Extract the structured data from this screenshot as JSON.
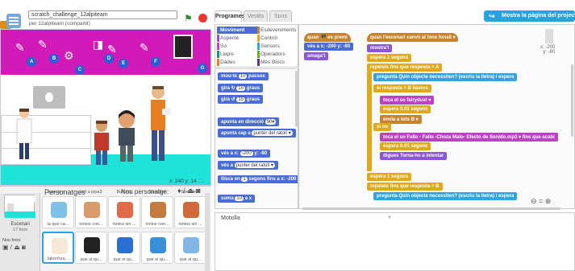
{
  "project": {
    "title": "scratch_challenge_12alpiteam",
    "author": "per 12alpiteam (compartit)"
  },
  "stage": {
    "coords": "x: 240  y: 14",
    "banner_letters": [
      "A",
      "B",
      "C",
      "D",
      "E",
      "F",
      "G"
    ],
    "bubble_color": "#2a5fd4",
    "banner_color": "#d21ab9",
    "floor_color": "#1de3d8"
  },
  "sprites_panel": {
    "header": "Personatges",
    "new_sprite": "Nou personatge:",
    "stage_label": "Escenari",
    "stage_sub": "17 fons",
    "new_bg": "Nou fons:",
    "top_captions": [
      "eure is o...",
      "pot a pipa3",
      "Button1",
      "Speaker",
      "Speaker2"
    ],
    "tiles": [
      {
        "name": "la que ca...",
        "color": "#7ec0e8"
      },
      {
        "name": "ninios con...",
        "color": "#d99b6c"
      },
      {
        "name": "ninios sin ...",
        "color": "#e26a4a"
      },
      {
        "name": "ninios con...",
        "color": "#c47b3f"
      },
      {
        "name": "ninios sin ...",
        "color": "#d06a3c"
      },
      {
        "name": "laborfora...",
        "color": "#f3e9d6"
      },
      {
        "name": "que si qu...",
        "color": "#222222"
      },
      {
        "name": "que si qu...",
        "color": "#2a6fd4"
      },
      {
        "name": "que si qu...",
        "color": "#3a8fd9"
      },
      {
        "name": "que si qu...",
        "color": "#7fb6e6"
      }
    ]
  },
  "tabs": [
    "Programes",
    "Vestits",
    "Sons"
  ],
  "share_button": "Mostra la pàgina del projecte",
  "categories": [
    {
      "label": "Moviment",
      "color": "#4a6cd4",
      "selected": true
    },
    {
      "label": "Esdeveniments",
      "color": "#c88330",
      "selected": false
    },
    {
      "label": "Aspecte",
      "color": "#8a55d7",
      "selected": false
    },
    {
      "label": "Control",
      "color": "#e1a91a",
      "selected": false
    },
    {
      "label": "So",
      "color": "#bb42c3",
      "selected": false
    },
    {
      "label": "Sensors",
      "color": "#2ca5e2",
      "selected": false
    },
    {
      "label": "Llapis",
      "color": "#0e9a6c",
      "selected": false
    },
    {
      "label": "Operadors",
      "color": "#5cb712",
      "selected": false
    },
    {
      "label": "Dades",
      "color": "#ee7d16",
      "selected": false
    },
    {
      "label": "Més Blocs",
      "color": "#632d99",
      "selected": false
    }
  ],
  "palette_blocks": [
    {
      "text": "mou-te",
      "slot": "10",
      "tail": "passos"
    },
    {
      "text": "gira ↻",
      "slot": "15",
      "tail": "graus"
    },
    {
      "text": "gira ↺",
      "slot": "15",
      "tail": "graus"
    },
    {
      "text": "apunta en direcció",
      "slot": "90▾",
      "tail": ""
    },
    {
      "text": "apunta cap a",
      "slot": "punter del ratolí ▾",
      "tail": ""
    },
    {
      "text": "vés a x:",
      "slot": "-200",
      "tail": "y: -80"
    },
    {
      "text": "vés a",
      "slot": "punter del ratolí ▾",
      "tail": ""
    },
    {
      "text": "llisca en",
      "slot": "1",
      "tail": "segons fins a x: -200"
    },
    {
      "text": "suma",
      "slot": "10",
      "tail": "a x"
    }
  ],
  "scripts": {
    "left_stack": [
      {
        "text": "quan 🏴 es premi",
        "kind": "events"
      },
      {
        "text": "vés a x: -200 y: -80",
        "kind": "motion"
      },
      {
        "text": "amaga't",
        "kind": "looks"
      }
    ],
    "main_stack": [
      {
        "text": "quan l'escenari canvii al fons fons8 ▾",
        "kind": "events"
      },
      {
        "text": "mostra't",
        "kind": "looks"
      },
      {
        "text": "espera 1 segons",
        "kind": "control"
      },
      {
        "text": "repeteix fins que  resposta = A",
        "kind": "control"
      },
      {
        "text": "pregunta Quin objecte necessiten? (escriu la lletra) i espera",
        "kind": "sensing"
      },
      {
        "text": "si  resposta = B  llavors",
        "kind": "control"
      },
      {
        "text": "toca el so fairydust ▾",
        "kind": "sound"
      },
      {
        "text": "espera 0.01 segons",
        "kind": "control"
      },
      {
        "text": "envia a tots B ▾",
        "kind": "events"
      },
      {
        "text": "si no",
        "kind": "control"
      },
      {
        "text": "toca el so Fallo - Fallo -Choza Malo- Efecto de Sonido.mp3 ▾ fins que acabi",
        "kind": "sound"
      },
      {
        "text": "espera 0.01 segons",
        "kind": "control"
      },
      {
        "text": "digues Torna-ho a intentar",
        "kind": "looks"
      },
      {
        "text": "espera 1 segons",
        "kind": "control"
      },
      {
        "text": "repeteix fins que  resposta = B",
        "kind": "control"
      },
      {
        "text": "pregunta Quin objecte necessiten? (escriu la lletra) i espera",
        "kind": "sensing"
      }
    ]
  },
  "sprite_xy": {
    "x": "x: -200",
    "y": "y: -80"
  },
  "zoom_controls": "⊖ = ⊕",
  "backpack": "Motxilla"
}
